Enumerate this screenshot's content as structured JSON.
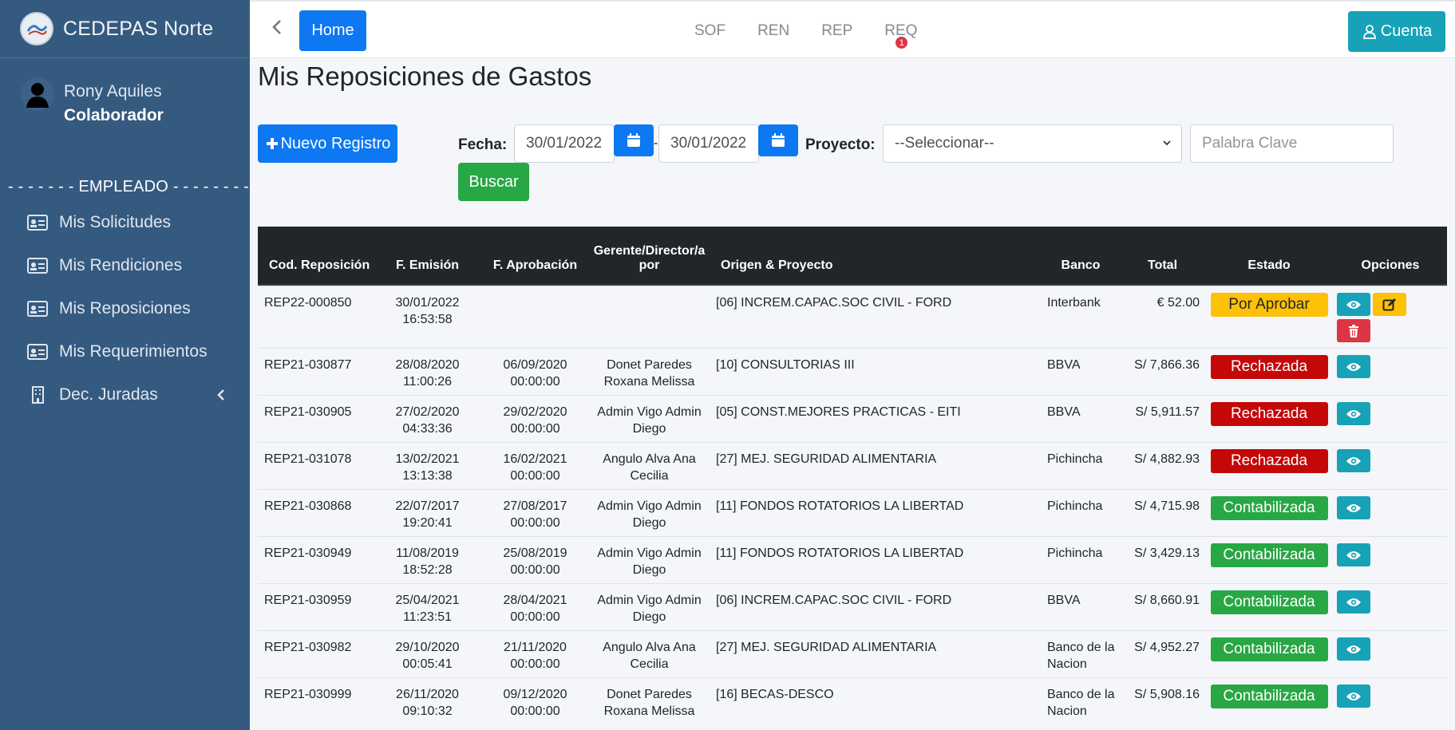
{
  "sidebar": {
    "brand": "CEDEPAS Norte",
    "user_name": "Rony Aquiles",
    "user_role": "Colaborador",
    "section_label": "- - - - - - - EMPLEADO - - - - - - - -",
    "items": [
      {
        "label": "Mis Solicitudes",
        "icon": "id-card-icon"
      },
      {
        "label": "Mis Rendiciones",
        "icon": "id-card-icon"
      },
      {
        "label": "Mis Reposiciones",
        "icon": "id-card-icon"
      },
      {
        "label": "Mis Requerimientos",
        "icon": "id-card-icon"
      },
      {
        "label": "Dec. Juradas",
        "icon": "building-icon"
      }
    ]
  },
  "topbar": {
    "home": "Home",
    "links": [
      "SOF",
      "REN",
      "REP",
      "REQ"
    ],
    "req_badge": "1",
    "account": "Cuenta"
  },
  "page": {
    "title": "Mis Reposiciones de Gastos",
    "new_button": "Nuevo Registro",
    "fecha_label": "Fecha:",
    "date_from": "30/01/2022",
    "date_sep": "-",
    "date_to": "30/01/2022",
    "proyecto_label": "Proyecto:",
    "proyecto_value": "--Seleccionar--",
    "keyword_placeholder": "Palabra Clave",
    "search_button": "Buscar"
  },
  "table": {
    "headers": {
      "cod": "Cod. Reposición",
      "emision": "F. Emisión",
      "aprobacion": "F. Aprobación",
      "gerente": "Gerente/Director/a por",
      "origen": "Origen & Proyecto",
      "banco": "Banco",
      "total": "Total",
      "estado": "Estado",
      "opciones": "Opciones"
    },
    "rows": [
      {
        "cod": "REP22-000850",
        "emision_d": "30/01/2022",
        "emision_t": "16:53:58",
        "aprob_d": "",
        "aprob_t": "",
        "gerente": "",
        "origen": "[06] INCREM.CAPAC.SOC CIVIL - FORD",
        "banco": "Interbank",
        "total": "€ 52.00",
        "estado": "Por Aprobar",
        "estado_type": "por"
      },
      {
        "cod": "REP21-030877",
        "emision_d": "28/08/2020",
        "emision_t": "11:00:26",
        "aprob_d": "06/09/2020",
        "aprob_t": "00:00:00",
        "gerente": "Donet Paredes Roxana Melissa",
        "origen": "[10] CONSULTORIAS III",
        "banco": "BBVA",
        "total": "S/ 7,866.36",
        "estado": "Rechazada",
        "estado_type": "rech"
      },
      {
        "cod": "REP21-030905",
        "emision_d": "27/02/2020",
        "emision_t": "04:33:36",
        "aprob_d": "29/02/2020",
        "aprob_t": "00:00:00",
        "gerente": "Admin Vigo Admin Diego",
        "origen": "[05] CONST.MEJORES PRACTICAS - EITI",
        "banco": "BBVA",
        "total": "S/ 5,911.57",
        "estado": "Rechazada",
        "estado_type": "rech"
      },
      {
        "cod": "REP21-031078",
        "emision_d": "13/02/2021",
        "emision_t": "13:13:38",
        "aprob_d": "16/02/2021",
        "aprob_t": "00:00:00",
        "gerente": "Angulo Alva Ana Cecilia",
        "origen": "[27] MEJ. SEGURIDAD ALIMENTARIA",
        "banco": "Pichincha",
        "total": "S/ 4,882.93",
        "estado": "Rechazada",
        "estado_type": "rech"
      },
      {
        "cod": "REP21-030868",
        "emision_d": "22/07/2017",
        "emision_t": "19:20:41",
        "aprob_d": "27/08/2017",
        "aprob_t": "00:00:00",
        "gerente": "Admin Vigo Admin Diego",
        "origen": "[11] FONDOS ROTATORIOS LA LIBERTAD",
        "banco": "Pichincha",
        "total": "S/ 4,715.98",
        "estado": "Contabilizada",
        "estado_type": "cont"
      },
      {
        "cod": "REP21-030949",
        "emision_d": "11/08/2019",
        "emision_t": "18:52:28",
        "aprob_d": "25/08/2019",
        "aprob_t": "00:00:00",
        "gerente": "Admin Vigo Admin Diego",
        "origen": "[11] FONDOS ROTATORIOS LA LIBERTAD",
        "banco": "Pichincha",
        "total": "S/ 3,429.13",
        "estado": "Contabilizada",
        "estado_type": "cont"
      },
      {
        "cod": "REP21-030959",
        "emision_d": "25/04/2021",
        "emision_t": "11:23:51",
        "aprob_d": "28/04/2021",
        "aprob_t": "00:00:00",
        "gerente": "Admin Vigo Admin Diego",
        "origen": "[06] INCREM.CAPAC.SOC CIVIL - FORD",
        "banco": "BBVA",
        "total": "S/ 8,660.91",
        "estado": "Contabilizada",
        "estado_type": "cont"
      },
      {
        "cod": "REP21-030982",
        "emision_d": "29/10/2020",
        "emision_t": "00:05:41",
        "aprob_d": "21/11/2020",
        "aprob_t": "00:00:00",
        "gerente": "Angulo Alva Ana Cecilia",
        "origen": "[27] MEJ. SEGURIDAD ALIMENTARIA",
        "banco": "Banco de la Nacion",
        "total": "S/ 4,952.27",
        "estado": "Contabilizada",
        "estado_type": "cont"
      },
      {
        "cod": "REP21-030999",
        "emision_d": "26/11/2020",
        "emision_t": "09:10:32",
        "aprob_d": "09/12/2020",
        "aprob_t": "00:00:00",
        "gerente": "Donet Paredes Roxana Melissa",
        "origen": "[16] BECAS-DESCO",
        "banco": "Banco de la Nacion",
        "total": "S/ 5,908.16",
        "estado": "Contabilizada",
        "estado_type": "cont"
      }
    ]
  },
  "colors": {
    "sidebar": "#355a80",
    "primary": "#0d78f2",
    "info": "#17a2b8",
    "success": "#28a745",
    "danger": "#c40808",
    "warning": "#ffc107",
    "table_header": "#22262b"
  }
}
